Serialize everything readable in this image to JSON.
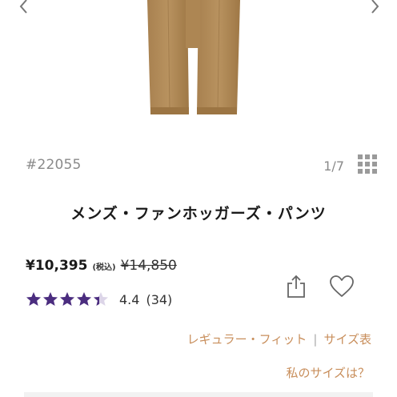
{
  "carousel": {
    "image_alt": "khaki pants",
    "prev_icon": "chevron-left-icon",
    "next_icon": "chevron-right-icon",
    "counter": "1/7",
    "grid_icon": "grid-icon"
  },
  "product": {
    "sku": "#22055",
    "title": "メンズ・ファンホッガーズ・パンツ",
    "price": "¥10,395",
    "tax_label": "(税込)",
    "original_price": "¥14,850",
    "rating": {
      "stars": 4.4,
      "value": "4.4",
      "count": "(34)"
    }
  },
  "actions": {
    "share_icon": "share-icon",
    "favorite_icon": "heart-icon"
  },
  "links": {
    "fit": "レギュラー・フィット",
    "separator": "|",
    "size_chart": "サイズ表",
    "my_size": "私のサイズは？"
  },
  "colors": {
    "accent": "#c88e5b",
    "star": "#4b2d7f",
    "product": "#b08a5a"
  }
}
